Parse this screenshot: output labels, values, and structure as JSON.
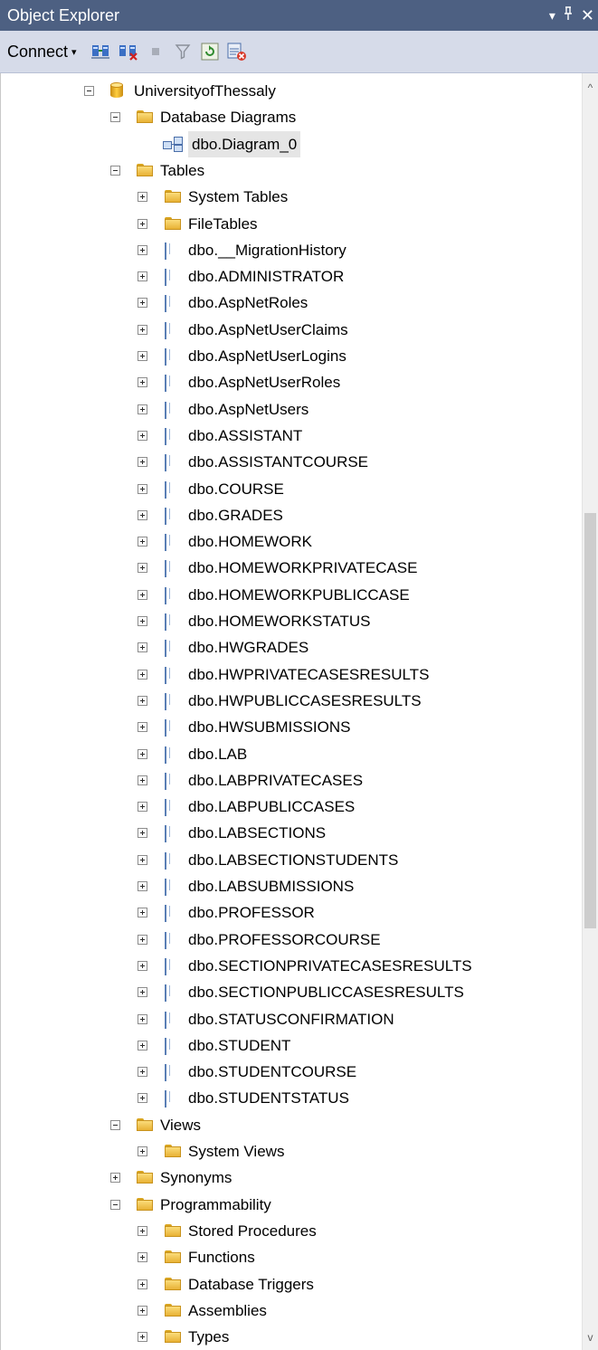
{
  "window": {
    "title": "Object Explorer",
    "controls": {
      "dropdown": "▾",
      "pin": "ᵖ",
      "close": "✕"
    }
  },
  "toolbar": {
    "connect_label": "Connect",
    "connect_arrow": "▾",
    "buttons": [
      "connect-object-explorer-icon",
      "disconnect-icon",
      "stop-icon",
      "filter-icon",
      "refresh-icon",
      "activity-monitor-icon"
    ]
  },
  "tree": [
    {
      "label": "UniversityofThessaly",
      "level": 0,
      "icon": "database",
      "expander": "minus"
    },
    {
      "label": "Database Diagrams",
      "level": 1,
      "icon": "folder",
      "expander": "minus"
    },
    {
      "label": "dbo.Diagram_0",
      "level": 2,
      "icon": "diagram",
      "expander": "none",
      "selected": true
    },
    {
      "label": "Tables",
      "level": 1,
      "icon": "folder",
      "expander": "minus"
    },
    {
      "label": "System Tables",
      "level": 2,
      "icon": "folder",
      "expander": "plus"
    },
    {
      "label": "FileTables",
      "level": 2,
      "icon": "folder",
      "expander": "plus"
    },
    {
      "label": "dbo.__MigrationHistory",
      "level": 2,
      "icon": "table",
      "expander": "plus"
    },
    {
      "label": "dbo.ADMINISTRATOR",
      "level": 2,
      "icon": "table",
      "expander": "plus"
    },
    {
      "label": "dbo.AspNetRoles",
      "level": 2,
      "icon": "table",
      "expander": "plus"
    },
    {
      "label": "dbo.AspNetUserClaims",
      "level": 2,
      "icon": "table",
      "expander": "plus"
    },
    {
      "label": "dbo.AspNetUserLogins",
      "level": 2,
      "icon": "table",
      "expander": "plus"
    },
    {
      "label": "dbo.AspNetUserRoles",
      "level": 2,
      "icon": "table",
      "expander": "plus"
    },
    {
      "label": "dbo.AspNetUsers",
      "level": 2,
      "icon": "table",
      "expander": "plus"
    },
    {
      "label": "dbo.ASSISTANT",
      "level": 2,
      "icon": "table",
      "expander": "plus"
    },
    {
      "label": "dbo.ASSISTANTCOURSE",
      "level": 2,
      "icon": "table",
      "expander": "plus"
    },
    {
      "label": "dbo.COURSE",
      "level": 2,
      "icon": "table",
      "expander": "plus"
    },
    {
      "label": "dbo.GRADES",
      "level": 2,
      "icon": "table",
      "expander": "plus"
    },
    {
      "label": "dbo.HOMEWORK",
      "level": 2,
      "icon": "table",
      "expander": "plus"
    },
    {
      "label": "dbo.HOMEWORKPRIVATECASE",
      "level": 2,
      "icon": "table",
      "expander": "plus"
    },
    {
      "label": "dbo.HOMEWORKPUBLICCASE",
      "level": 2,
      "icon": "table",
      "expander": "plus"
    },
    {
      "label": "dbo.HOMEWORKSTATUS",
      "level": 2,
      "icon": "table",
      "expander": "plus"
    },
    {
      "label": "dbo.HWGRADES",
      "level": 2,
      "icon": "table",
      "expander": "plus"
    },
    {
      "label": "dbo.HWPRIVATECASESRESULTS",
      "level": 2,
      "icon": "table",
      "expander": "plus"
    },
    {
      "label": "dbo.HWPUBLICCASESRESULTS",
      "level": 2,
      "icon": "table",
      "expander": "plus"
    },
    {
      "label": "dbo.HWSUBMISSIONS",
      "level": 2,
      "icon": "table",
      "expander": "plus"
    },
    {
      "label": "dbo.LAB",
      "level": 2,
      "icon": "table",
      "expander": "plus"
    },
    {
      "label": "dbo.LABPRIVATECASES",
      "level": 2,
      "icon": "table",
      "expander": "plus"
    },
    {
      "label": "dbo.LABPUBLICCASES",
      "level": 2,
      "icon": "table",
      "expander": "plus"
    },
    {
      "label": "dbo.LABSECTIONS",
      "level": 2,
      "icon": "table",
      "expander": "plus"
    },
    {
      "label": "dbo.LABSECTIONSTUDENTS",
      "level": 2,
      "icon": "table",
      "expander": "plus"
    },
    {
      "label": "dbo.LABSUBMISSIONS",
      "level": 2,
      "icon": "table",
      "expander": "plus"
    },
    {
      "label": "dbo.PROFESSOR",
      "level": 2,
      "icon": "table",
      "expander": "plus"
    },
    {
      "label": "dbo.PROFESSORCOURSE",
      "level": 2,
      "icon": "table",
      "expander": "plus"
    },
    {
      "label": "dbo.SECTIONPRIVATECASESRESULTS",
      "level": 2,
      "icon": "table",
      "expander": "plus"
    },
    {
      "label": "dbo.SECTIONPUBLICCASESRESULTS",
      "level": 2,
      "icon": "table",
      "expander": "plus"
    },
    {
      "label": "dbo.STATUSCONFIRMATION",
      "level": 2,
      "icon": "table",
      "expander": "plus"
    },
    {
      "label": "dbo.STUDENT",
      "level": 2,
      "icon": "table",
      "expander": "plus"
    },
    {
      "label": "dbo.STUDENTCOURSE",
      "level": 2,
      "icon": "table",
      "expander": "plus"
    },
    {
      "label": "dbo.STUDENTSTATUS",
      "level": 2,
      "icon": "table",
      "expander": "plus"
    },
    {
      "label": "Views",
      "level": 1,
      "icon": "folder",
      "expander": "minus"
    },
    {
      "label": "System Views",
      "level": 2,
      "icon": "folder",
      "expander": "plus"
    },
    {
      "label": "Synonyms",
      "level": 1,
      "icon": "folder",
      "expander": "plus"
    },
    {
      "label": "Programmability",
      "level": 1,
      "icon": "folder",
      "expander": "minus"
    },
    {
      "label": "Stored Procedures",
      "level": 2,
      "icon": "folder",
      "expander": "plus"
    },
    {
      "label": "Functions",
      "level": 2,
      "icon": "folder",
      "expander": "plus"
    },
    {
      "label": "Database Triggers",
      "level": 2,
      "icon": "folder",
      "expander": "plus"
    },
    {
      "label": "Assemblies",
      "level": 2,
      "icon": "folder",
      "expander": "plus"
    },
    {
      "label": "Types",
      "level": 2,
      "icon": "folder",
      "expander": "plus"
    }
  ],
  "scrollbar": {
    "up_arrow": "^",
    "down_arrow": "v",
    "position_fraction": 0.5,
    "visible_fraction": 0.34
  },
  "colors": {
    "title_bar": "#4d6082",
    "toolbar": "#d6dbe9",
    "selection": "#e5e5e5"
  }
}
